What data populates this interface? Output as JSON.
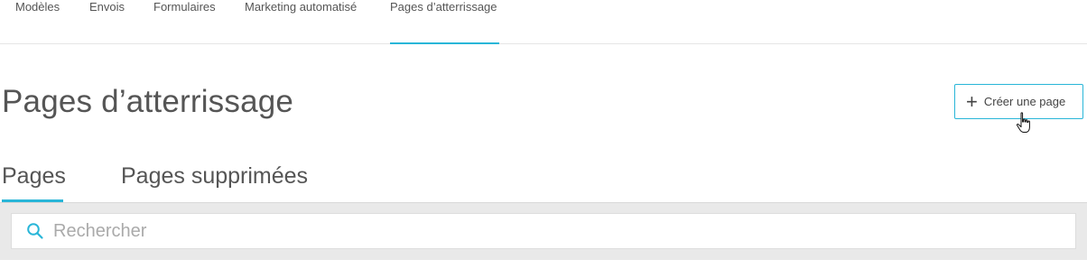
{
  "top_nav": {
    "items": [
      {
        "label": "Modèles",
        "active": false
      },
      {
        "label": "Envois",
        "active": false
      },
      {
        "label": "Formulaires",
        "active": false
      },
      {
        "label": "Marketing automatisé",
        "active": false
      },
      {
        "label": "Pages d’atterrissage",
        "active": true
      }
    ]
  },
  "header": {
    "title": "Pages d’atterrissage",
    "create_button": {
      "icon": "plus-icon",
      "label": "Créer une page"
    }
  },
  "tabs": [
    {
      "label": "Pages",
      "active": true
    },
    {
      "label": "Pages supprimées",
      "active": false
    }
  ],
  "search": {
    "icon": "search-icon",
    "placeholder": "Rechercher",
    "value": ""
  },
  "colors": {
    "accent": "#29b6d8",
    "text": "#555555",
    "panel_bg": "#e9e9e9"
  }
}
